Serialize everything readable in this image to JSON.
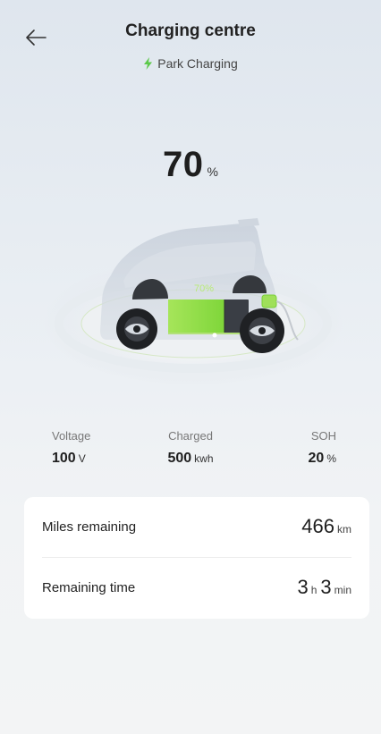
{
  "header": {
    "title": "Charging centre",
    "mode": "Park Charging"
  },
  "battery": {
    "percent": "70",
    "percent_unit": "%",
    "car_label": "70%",
    "level": 0.7
  },
  "stats": [
    {
      "label": "Voltage",
      "value": "100",
      "unit": "V"
    },
    {
      "label": "Charged",
      "value": "500",
      "unit": "kwh"
    },
    {
      "label": "SOH",
      "value": "20",
      "unit": "%"
    }
  ],
  "card": {
    "miles_label": "Miles remaining",
    "miles_value": "466",
    "miles_unit": "km",
    "time_label": "Remaining time",
    "hours": "3",
    "hours_unit": "h",
    "minutes": "3",
    "minutes_unit": "min"
  },
  "colors": {
    "accent": "#8fe04a",
    "bolt": "#5cc94a"
  }
}
